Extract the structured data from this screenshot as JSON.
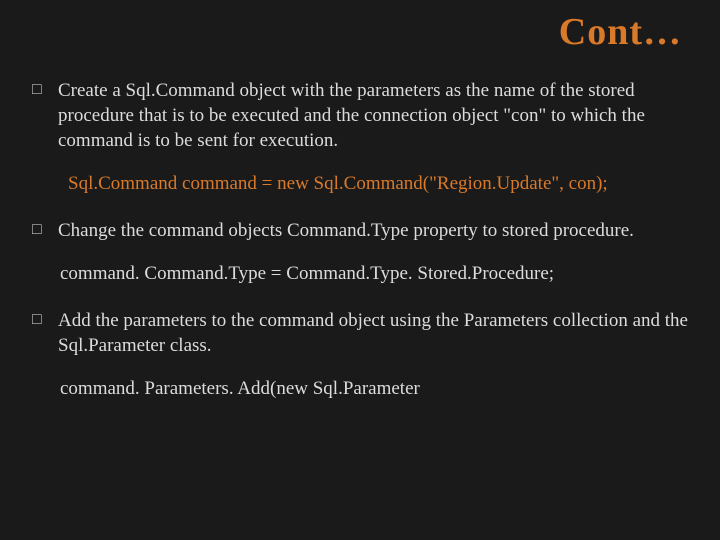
{
  "title": "Cont…",
  "items": [
    {
      "marker": "□",
      "text": "Create a Sql.Command object with the parameters as the name of the stored procedure that is to be executed and the connection object \"con\" to which the command is to be sent for execution.",
      "code": " Sql.Command command = new Sql.Command(\"Region.Update\", con);",
      "codeColor": "orange"
    },
    {
      "marker": "□",
      "text": "Change the command objects Command.Type property to stored procedure.",
      "code": "command. Command.Type = Command.Type. Stored.Procedure;",
      "codeColor": "plain"
    },
    {
      "marker": "□",
      "text": "Add the parameters to the command object using the Parameters collection and the Sql.Parameter class.",
      "code": "command. Parameters. Add(new Sql.Parameter",
      "codeColor": "plain"
    }
  ]
}
